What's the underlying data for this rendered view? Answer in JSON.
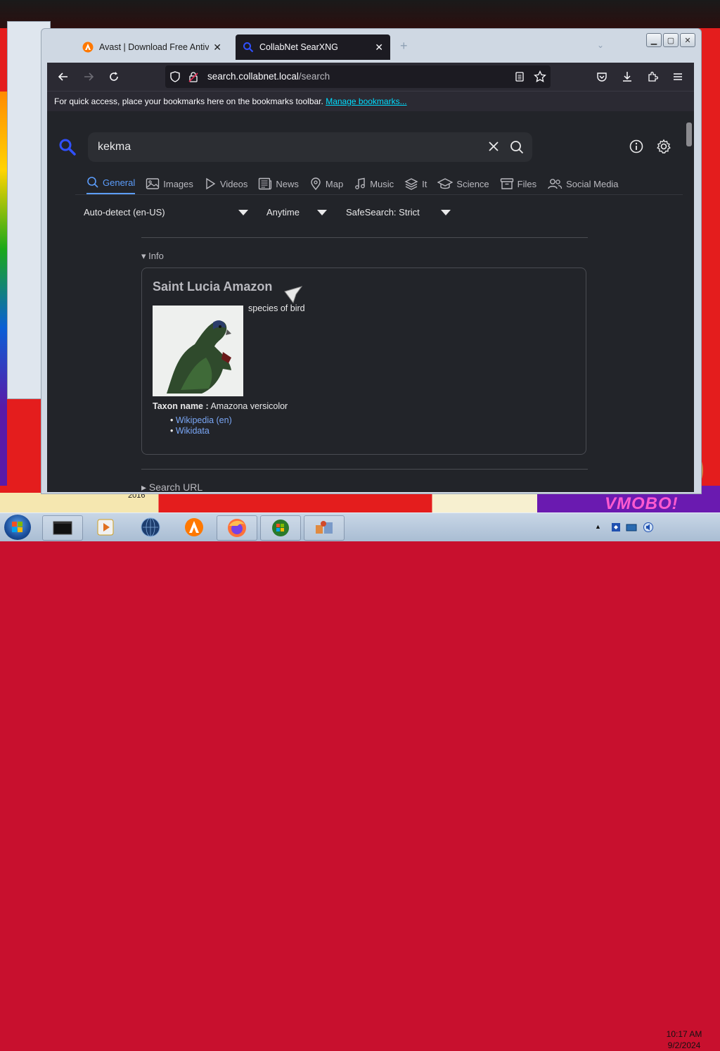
{
  "browser": {
    "tabs": [
      {
        "title": "Avast | Download Free Antiviru",
        "active": false
      },
      {
        "title": "CollabNet SearXNG",
        "active": true
      }
    ],
    "url_host": "search.collabnet.local",
    "url_path": "/search",
    "bookmarks_bar_text": "For quick access, place your bookmarks here on the bookmarks toolbar.",
    "bookmarks_bar_link": "Manage bookmarks..."
  },
  "search": {
    "query": "kekma",
    "categories": [
      {
        "label": "General",
        "icon": "search-icon",
        "active": true
      },
      {
        "label": "Images",
        "icon": "image-icon",
        "active": false
      },
      {
        "label": "Videos",
        "icon": "play-icon",
        "active": false
      },
      {
        "label": "News",
        "icon": "newspaper-icon",
        "active": false
      },
      {
        "label": "Map",
        "icon": "map-pin-icon",
        "active": false
      },
      {
        "label": "Music",
        "icon": "music-icon",
        "active": false
      },
      {
        "label": "It",
        "icon": "layers-icon",
        "active": false
      },
      {
        "label": "Science",
        "icon": "school-icon",
        "active": false
      },
      {
        "label": "Files",
        "icon": "archive-icon",
        "active": false
      },
      {
        "label": "Social Media",
        "icon": "people-icon",
        "active": false
      }
    ],
    "filters": {
      "language": "Auto-detect (en-US)",
      "time": "Anytime",
      "safesearch": "SafeSearch: Strict"
    }
  },
  "infobox": {
    "toggle": "Info",
    "title": "Saint Lucia Amazon",
    "description": "species of bird",
    "taxon_label": "Taxon name :",
    "taxon_value": "Amazona versicolor",
    "links": [
      "Wikipedia (en)",
      "Wikidata"
    ]
  },
  "search_url_toggle": "Search URL",
  "desktop": {
    "year_label": "2016",
    "watermark_text": "VMOBO!"
  },
  "taskbar": {
    "time": "10:17 AM",
    "date": "9/2/2024"
  },
  "colors": {
    "accent": "#5c9dfc",
    "page_bg": "#222429",
    "link": "#7aa7f6",
    "bookmark_link": "#00ddff"
  }
}
